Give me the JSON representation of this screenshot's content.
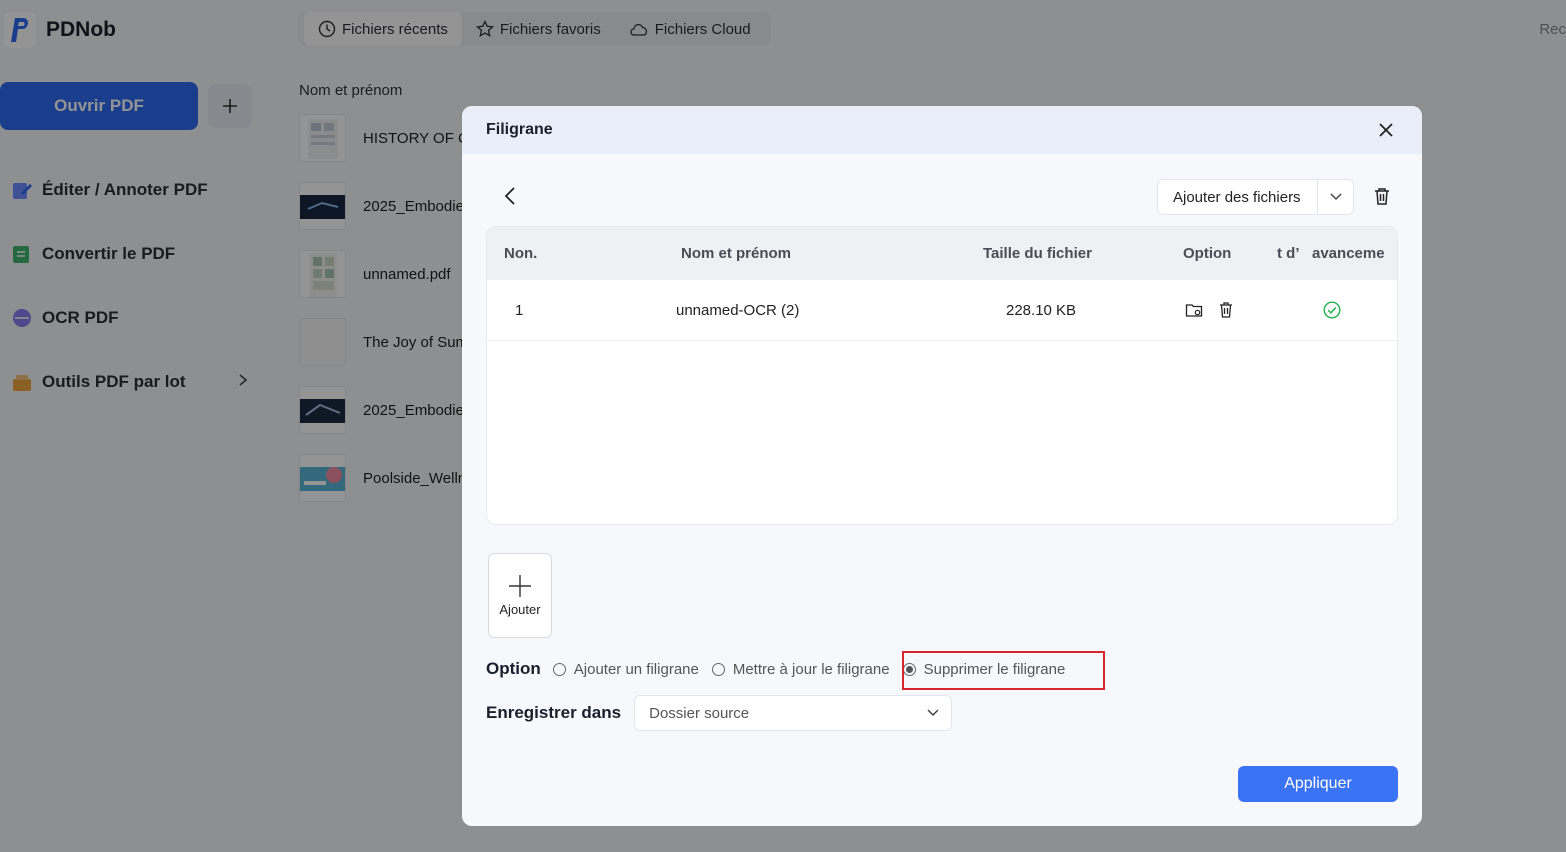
{
  "app": {
    "name": "PDNob",
    "open_pdf": "Ouvrir PDF",
    "sidebar": [
      {
        "label": "Éditer / Annoter PDF",
        "icon": "edit-icon"
      },
      {
        "label": "Convertir le PDF",
        "icon": "convert-icon"
      },
      {
        "label": "OCR PDF",
        "icon": "ocr-icon"
      },
      {
        "label": "Outils PDF par lot",
        "icon": "batch-icon"
      }
    ],
    "tabs": [
      {
        "label": "Fichiers récents",
        "icon": "clock-icon"
      },
      {
        "label": "Fichiers favoris",
        "icon": "star-icon"
      },
      {
        "label": "Fichiers Cloud",
        "icon": "cloud-icon"
      }
    ],
    "top_right": "Rec",
    "list_header": "Nom et prénom",
    "files": [
      "HISTORY OF CI",
      "2025_Embodie",
      "unnamed.pdf",
      "The Joy of Sum",
      "2025_Embodie",
      "Poolside_Welln"
    ]
  },
  "modal": {
    "title": "Filigrane",
    "add_files": "Ajouter des fichiers",
    "columns": [
      "Non.",
      "Nom et prénom",
      "Taille du fichier",
      "Option",
      "t d’",
      "avanceme"
    ],
    "rows": [
      {
        "index": "1",
        "name": "unnamed-OCR (2)",
        "size": "228.10 KB",
        "status": "done"
      }
    ],
    "add_tile": "Ajouter",
    "option_label": "Option",
    "options": [
      "Ajouter un filigrane",
      "Mettre à jour le filigrane",
      "Supprimer le filigrane"
    ],
    "selected_option": 2,
    "save_label": "Enregistrer dans",
    "save_value": "Dossier source",
    "apply": "Appliquer"
  },
  "colors": {
    "accent": "#3b73f5",
    "highlight": "#d6262e",
    "success": "#22b24c"
  }
}
